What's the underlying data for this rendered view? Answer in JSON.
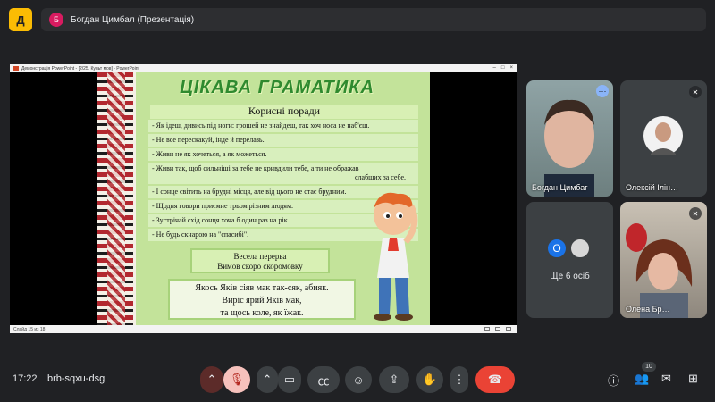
{
  "app": {
    "icon_letter": "Д"
  },
  "presenting": {
    "avatar_letter": "Б",
    "title": "Богдан Цимбал (Презентація)"
  },
  "ppt": {
    "window_title": "Демонстрація PowerPoint - [2/25. Культ мов] - PowerPoint",
    "slide_counter": "Слайд 15 из 18"
  },
  "slide": {
    "title": "ЦІКАВА ГРАМАТИКА",
    "subtitle": "Корисні поради",
    "tips": [
      "- Як ідеш, дивись під ноги: грошей не знайдеш, так хоч носа не наб'єш.",
      "- Не все перескакуй, інде й перелазь.",
      "- Живи не як хочеться, а як можеться.",
      "- Живи так, щоб сильніші за тебе не кривдили тебе, а ти не ображав",
      "слабших за себе.",
      "- І сонце світить на брудні місця, але від цього не стає брудним.",
      "- Щодня говори приємне трьом різним людям.",
      "- Зустрічай схід сонця хоча б один раз на рік.",
      "- Не будь скнарою на \"спасибі\"."
    ],
    "break_box": [
      "Весела перерва",
      "Вимов скоро скоромовку"
    ],
    "poem": [
      "Якось Яків сіяв мак так-сяк, абияк.",
      "Виріс ярий Яків мак,",
      "та щось коле, як їжак."
    ]
  },
  "participants": [
    {
      "name": "Богдан Цимбаг",
      "more_icon": "more-vert-icon"
    },
    {
      "name": "Олексій Ілін…",
      "mic": "mic-off-icon"
    },
    {
      "overflow_label": "Ще 6 осіб",
      "avatar_letter": "О"
    },
    {
      "name": "Олена Бр…",
      "mic": "mic-off-icon"
    }
  ],
  "bottom": {
    "time": "17:22",
    "meeting_code": "brb-sqxu-dsg",
    "people_count": "10"
  },
  "colors": {
    "bg": "#202124",
    "end_call": "#ea4335",
    "accent": "#8ab4f8",
    "slide_green": "#c3e39a"
  }
}
